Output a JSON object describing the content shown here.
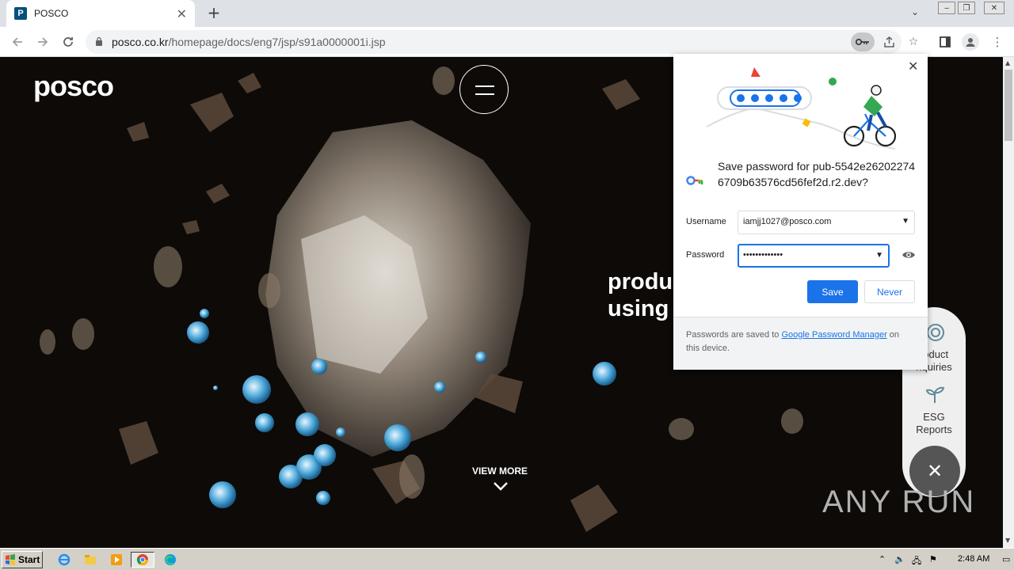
{
  "browser": {
    "tab": {
      "favicon": "P",
      "title": "POSCO",
      "close_icon": "✕"
    },
    "new_tab_icon": "+",
    "tab_search_icon": "⌄",
    "window_buttons": [
      "‒",
      "❐",
      "✕"
    ],
    "url_domain": "posco.co.kr",
    "url_path": "/homepage/docs/eng7/jsp/s91a0000001i.jsp"
  },
  "page": {
    "logo": "posco",
    "hero_line1": "produ",
    "hero_line2": "using",
    "view_more": "VIEW MORE",
    "quick_menu": {
      "item1_line1": "roduct",
      "item1_line2": "nquiries",
      "item2_line1": "ESG",
      "item2_line2": "Reports"
    },
    "watermark": "ANY RUN"
  },
  "password_bubble": {
    "title": "Save password for pub-5542e262022746709b63576cd56fef2d.r2.dev?",
    "username_label": "Username",
    "username_value": "iamjj1027@posco.com",
    "password_label": "Password",
    "password_value": "•••••••••••••",
    "save_label": "Save",
    "never_label": "Never",
    "footer_prefix": "Passwords are saved to ",
    "footer_link": "Google Password Manager",
    "footer_suffix": " on this device."
  },
  "taskbar": {
    "start_label": "Start",
    "clock": "2:48 AM"
  },
  "colors": {
    "accent": "#1a73e8",
    "brand": "#05507d"
  }
}
